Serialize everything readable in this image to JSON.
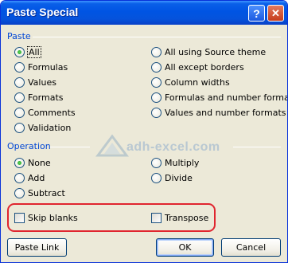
{
  "dialog": {
    "title": "Paste Special",
    "help_glyph": "?",
    "close_glyph": "✕"
  },
  "paste": {
    "section_label": "Paste",
    "options": [
      {
        "label": "All",
        "selected": true
      },
      {
        "label": "Formulas",
        "selected": false
      },
      {
        "label": "Values",
        "selected": false
      },
      {
        "label": "Formats",
        "selected": false
      },
      {
        "label": "Comments",
        "selected": false
      },
      {
        "label": "Validation",
        "selected": false
      },
      {
        "label": "All using Source theme",
        "selected": false
      },
      {
        "label": "All except borders",
        "selected": false
      },
      {
        "label": "Column widths",
        "selected": false
      },
      {
        "label": "Formulas and number formats",
        "selected": false
      },
      {
        "label": "Values and number formats",
        "selected": false
      }
    ]
  },
  "operation": {
    "section_label": "Operation",
    "options": [
      {
        "label": "None",
        "selected": true
      },
      {
        "label": "Add",
        "selected": false
      },
      {
        "label": "Subtract",
        "selected": false
      },
      {
        "label": "Multiply",
        "selected": false
      },
      {
        "label": "Divide",
        "selected": false
      }
    ]
  },
  "checks": {
    "skip_blanks": {
      "label": "Skip blanks",
      "checked": false
    },
    "transpose": {
      "label": "Transpose",
      "checked": false
    }
  },
  "watermark": {
    "text": "adh-excel.com"
  },
  "buttons": {
    "paste_link": "Paste Link",
    "ok": "OK",
    "cancel": "Cancel"
  }
}
